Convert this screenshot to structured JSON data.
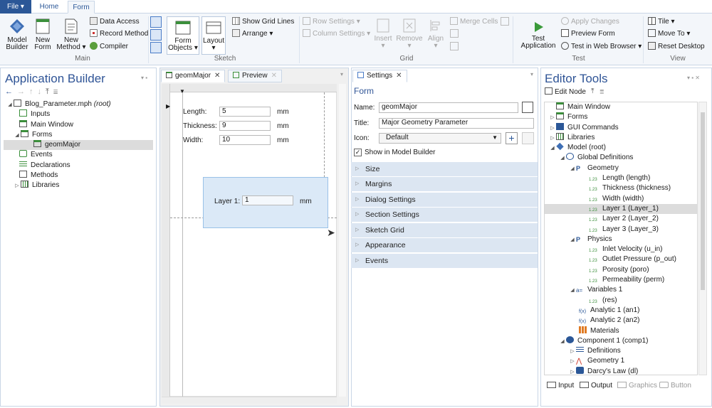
{
  "ribbon_tabs": {
    "file": "File",
    "home": "Home",
    "form": "Form"
  },
  "ribbon": {
    "model_builder": [
      "Model",
      "Builder"
    ],
    "new_form": [
      "New",
      "Form"
    ],
    "new_method": [
      "New",
      "Method"
    ],
    "data_access": "Data Access",
    "record_method": "Record Method",
    "compiler": "Compiler",
    "main_group": "Main",
    "form_objects": [
      "Form",
      "Objects"
    ],
    "layout": "Layout",
    "show_grid_lines": "Show Grid Lines",
    "arrange": "Arrange",
    "sketch_group": "Sketch",
    "row_settings": "Row Settings",
    "column_settings": "Column Settings",
    "insert": "Insert",
    "remove": "Remove",
    "align": "Align",
    "merge_cells": "Merge Cells",
    "grid_group": "Grid",
    "apply_changes": "Apply Changes",
    "test_application": [
      "Test",
      "Application"
    ],
    "preview_form": "Preview Form",
    "test_in_web_browser": "Test in Web Browser",
    "test_group": "Test",
    "tile": "Tile",
    "move_to": "Move To",
    "reset_desktop": "Reset Desktop",
    "view_group": "View"
  },
  "app_builder": {
    "title": "Application Builder",
    "tree": [
      {
        "label": "Blog_Parameter.mph",
        "suffix": "(root)"
      },
      {
        "label": "Inputs"
      },
      {
        "label": "Main Window"
      },
      {
        "label": "Forms"
      },
      {
        "label": "geomMajor"
      },
      {
        "label": "Events"
      },
      {
        "label": "Declarations"
      },
      {
        "label": "Methods"
      },
      {
        "label": "Libraries"
      }
    ]
  },
  "form_editor": {
    "tabs": [
      "geomMajor",
      "Preview"
    ],
    "fields": [
      {
        "label": "Length:",
        "value": "5",
        "unit": "mm"
      },
      {
        "label": "Thickness:",
        "value": "9",
        "unit": "mm"
      },
      {
        "label": "Width:",
        "value": "10",
        "unit": "mm"
      }
    ],
    "layer_label": "Layer 1:",
    "layer_value": "1",
    "layer_unit": "mm"
  },
  "settings": {
    "tab": "Settings",
    "header": "Form",
    "name_label": "Name:",
    "name_value": "geomMajor",
    "title_label": "Title:",
    "title_value": "Major Geometry Parameter",
    "icon_label": "Icon:",
    "icon_value": "Default",
    "show_in_model_builder": "Show in Model Builder",
    "sections": [
      "Size",
      "Margins",
      "Dialog Settings",
      "Section Settings",
      "Sketch Grid",
      "Appearance",
      "Events"
    ]
  },
  "editor_tools": {
    "title": "Editor Tools",
    "edit_node": "Edit Node",
    "tree": [
      "Main Window",
      "Forms",
      "GUI Commands",
      "Libraries",
      "Model (root)",
      "Global Definitions",
      "Geometry",
      "Length (length)",
      "Thickness (thickness)",
      "Width (width)",
      "Layer 1 (Layer_1)",
      "Layer 2 (Layer_2)",
      "Layer 3 (Layer_3)",
      "Physics",
      "Inlet Velocity (u_in)",
      "Outlet Pressure (p_out)",
      "Porosity (poro)",
      "Permeability (perm)",
      "Variables 1",
      "(res)",
      "Analytic 1 (an1)",
      "Analytic 2 (an2)",
      "Materials",
      "Component 1 (comp1)",
      "Definitions",
      "Geometry 1",
      "Darcy's Law (dl)"
    ],
    "bottom_buttons": [
      "Input",
      "Output",
      "Graphics",
      "Button"
    ]
  }
}
